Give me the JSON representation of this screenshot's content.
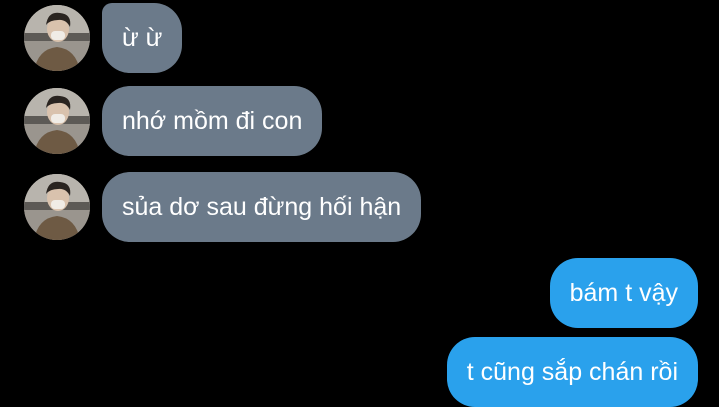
{
  "theme": {
    "background": "#000000",
    "incoming_bubble": "#6b7a8a",
    "outgoing_bubble": "#2aa1ec",
    "text_color": "#ffffff"
  },
  "contact": {
    "avatar_icon": "profile-photo-avatar-icon"
  },
  "messages": [
    {
      "direction": "incoming",
      "text": "ừ ừ"
    },
    {
      "direction": "incoming",
      "text": "nhớ mồm đi con"
    },
    {
      "direction": "incoming",
      "text": "sủa dơ sau đừng hối hận"
    },
    {
      "direction": "outgoing",
      "text": "bám t vậy"
    },
    {
      "direction": "outgoing",
      "text": "t cũng sắp chán rồi"
    }
  ]
}
